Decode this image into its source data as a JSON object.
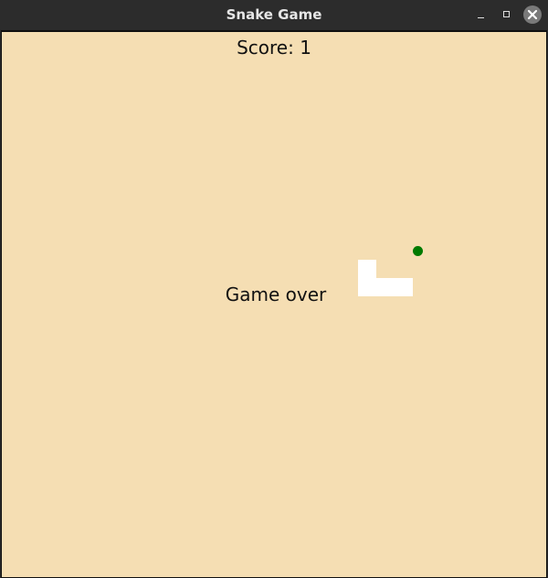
{
  "window": {
    "title": "Snake Game",
    "controls": {
      "minimize": "minimize-icon",
      "maximize": "maximize-icon",
      "close": "close-icon"
    }
  },
  "game": {
    "score_text": "Score: 1",
    "status_text": "Game over",
    "colors": {
      "background": "#f5deb3",
      "snake": "#ffffff",
      "food": "#007a00"
    }
  }
}
